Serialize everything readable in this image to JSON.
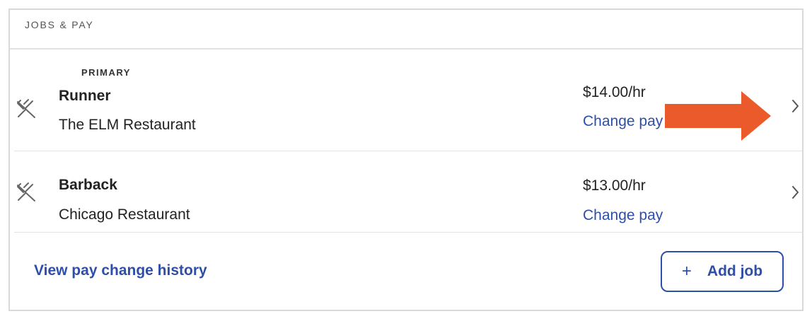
{
  "section": {
    "header": "JOBS & PAY"
  },
  "jobs": [
    {
      "tag": "PRIMARY",
      "title": "Runner",
      "location": "The ELM Restaurant",
      "pay": "$14.00/hr",
      "change_pay_label": "Change pay",
      "icon": "utensils-icon"
    },
    {
      "title": "Barback",
      "location": "Chicago Restaurant",
      "pay": "$13.00/hr",
      "change_pay_label": "Change pay",
      "icon": "utensils-icon"
    }
  ],
  "footer": {
    "history_link": "View pay change history",
    "add_job_icon": "+",
    "add_job_label": "Add job"
  },
  "colors": {
    "link_blue": "#2e4fa8",
    "annotation_arrow": "#eb5a2a",
    "border": "#d9d9d9"
  }
}
